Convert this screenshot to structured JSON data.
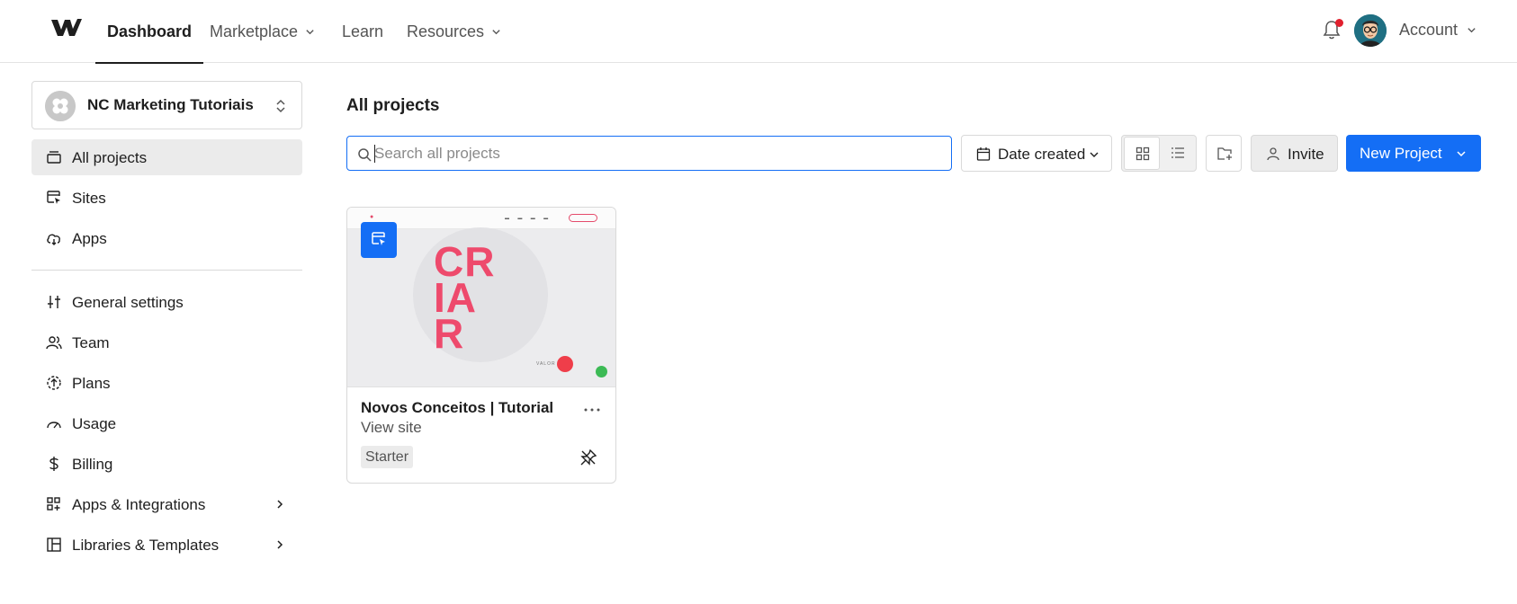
{
  "nav": {
    "logo_icon": "webflow-logo",
    "items": [
      {
        "label": "Dashboard",
        "active": true,
        "has_menu": false
      },
      {
        "label": "Marketplace",
        "active": false,
        "has_menu": true
      },
      {
        "label": "Learn",
        "active": false,
        "has_menu": false
      },
      {
        "label": "Resources",
        "active": false,
        "has_menu": true
      }
    ],
    "account_label": "Account",
    "notification_dot_color": "#e1202e"
  },
  "sidebar": {
    "workspace_name": "NC Marketing Tutoriais",
    "items": [
      {
        "label": "All projects",
        "icon": "folder-icon",
        "active": true
      },
      {
        "label": "Sites",
        "icon": "site-cursor-icon"
      },
      {
        "label": "Apps",
        "icon": "cloud-app-icon"
      },
      {
        "label": "General settings",
        "icon": "sliders-icon"
      },
      {
        "label": "Team",
        "icon": "team-icon"
      },
      {
        "label": "Plans",
        "icon": "plans-icon"
      },
      {
        "label": "Usage",
        "icon": "gauge-icon"
      },
      {
        "label": "Billing",
        "icon": "dollar-icon"
      },
      {
        "label": "Apps & Integrations",
        "icon": "apps-grid-icon",
        "has_submenu": true
      },
      {
        "label": "Libraries & Templates",
        "icon": "library-icon",
        "has_submenu": true
      }
    ]
  },
  "main": {
    "title": "All projects",
    "search": {
      "placeholder": "Search all projects",
      "value": ""
    },
    "sort_label": "Date created",
    "view_mode": "grid",
    "invite_label": "Invite",
    "new_project_label": "New Project",
    "accent_color": "#146ef5"
  },
  "projects": [
    {
      "name": "Novos Conceitos | Tutorial",
      "link_label": "View site",
      "plan": "Starter",
      "thumbnail_word": "CRIAR",
      "thumbnail_play_label": "VALOR"
    }
  ]
}
